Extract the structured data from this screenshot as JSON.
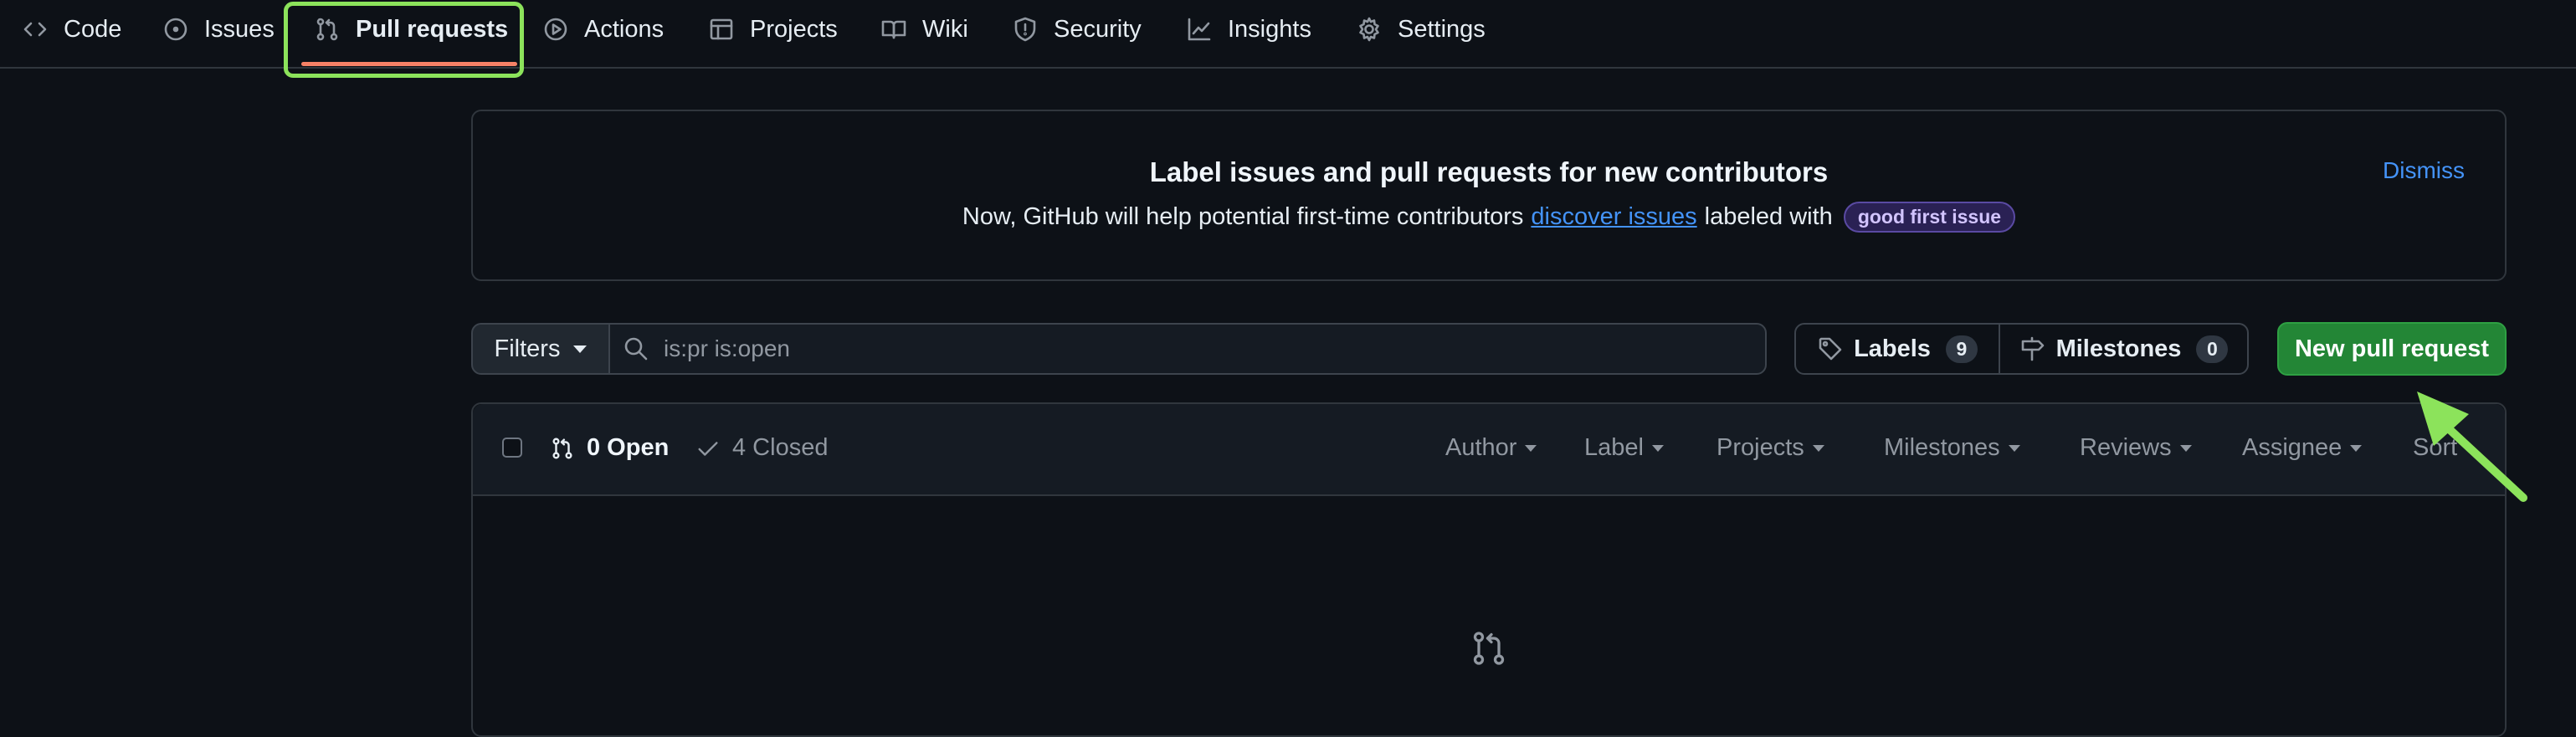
{
  "nav": {
    "items": [
      {
        "label": "Code",
        "icon": "code-icon"
      },
      {
        "label": "Issues",
        "icon": "issue-opened-icon"
      },
      {
        "label": "Pull requests",
        "icon": "git-pull-request-icon",
        "active": true
      },
      {
        "label": "Actions",
        "icon": "play-icon"
      },
      {
        "label": "Projects",
        "icon": "table-icon"
      },
      {
        "label": "Wiki",
        "icon": "book-icon"
      },
      {
        "label": "Security",
        "icon": "shield-icon"
      },
      {
        "label": "Insights",
        "icon": "graph-icon"
      },
      {
        "label": "Settings",
        "icon": "gear-icon"
      }
    ]
  },
  "banner": {
    "title": "Label issues and pull requests for new contributors",
    "text_before": "Now, GitHub will help potential first-time contributors",
    "link_text": "discover issues",
    "text_after": "labeled with",
    "label": "good first issue",
    "dismiss": "Dismiss"
  },
  "filters": {
    "button_label": "Filters",
    "search_value": "is:pr is:open",
    "labels_label": "Labels",
    "labels_count": "9",
    "milestones_label": "Milestones",
    "milestones_count": "0",
    "new_pr_label": "New pull request"
  },
  "list": {
    "open_label": "0 Open",
    "closed_label": "4 Closed",
    "menus": [
      "Author",
      "Label",
      "Projects",
      "Milestones",
      "Reviews",
      "Assignee",
      "Sort"
    ]
  },
  "colors": {
    "background": "#0d1117",
    "accent_green": "#238636",
    "link_blue": "#4493f8",
    "active_underline": "#f78166",
    "annotation_green": "#8ce35b"
  }
}
